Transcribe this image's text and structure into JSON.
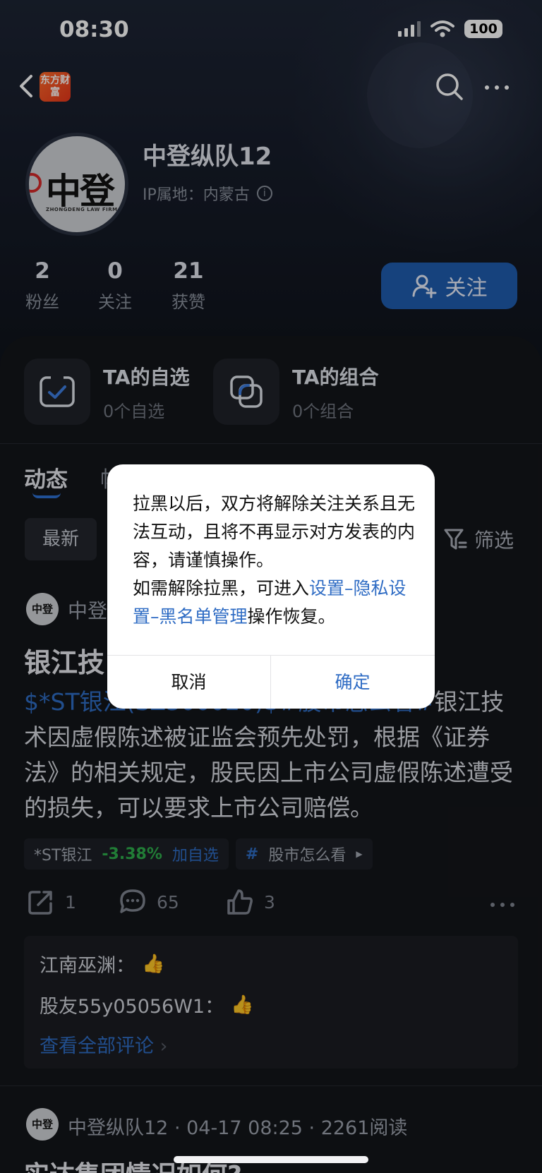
{
  "status": {
    "time": "08:30",
    "battery": "100"
  },
  "nav": {
    "logo": "东方财富"
  },
  "profile": {
    "avatar_text": "中登",
    "avatar_sub": "ZHONGDENG LAW FIRM",
    "name": "中登纵队12",
    "ip": "IP属地：内蒙古",
    "stats": [
      {
        "num": "2",
        "label": "粉丝"
      },
      {
        "num": "0",
        "label": "关注"
      },
      {
        "num": "21",
        "label": "获赞"
      }
    ],
    "follow_label": "关注"
  },
  "quick": [
    {
      "title": "TA的自选",
      "sub": "0个自选"
    },
    {
      "title": "TA的组合",
      "sub": "0个组合"
    }
  ],
  "tabs": {
    "active": "动态",
    "other": "帖"
  },
  "filter": {
    "chip": "最新",
    "label": "筛选"
  },
  "post": {
    "avatar_text": "中登",
    "author": "中登",
    "title": "银江技",
    "body_link": "$*ST银江(SZ300020)$#股市怎么看#",
    "body_text": "银江技术因虚假陈述被证监会预先处罚，根据《证券法》的相关规定，股民因上市公司虚假陈述遭受的损失，可以要求上市公司赔偿。",
    "stock_tag": {
      "name": "*ST银江",
      "pct": "-3.38%",
      "add": "加自选"
    },
    "topic_tag": {
      "hash": "#",
      "label": "股市怎么看"
    },
    "actions": {
      "share": "1",
      "comment": "65",
      "like": "3"
    },
    "comments": [
      {
        "user": "江南巫渊：",
        "emoji": "👍"
      },
      {
        "user": "股友55y05056W1：",
        "emoji": "👍"
      }
    ],
    "view_all": "查看全部评论"
  },
  "post2": {
    "avatar_text": "中登",
    "meta": "中登纵队12 · 04-17 08:25 · 2261阅读",
    "title": "实达集团情况如何?"
  },
  "dialog": {
    "line1": "拉黑以后，双方将解除关注关系且无法互动，且将不再显示对方发表的内容，请谨慎操作。",
    "line2_prefix": "如需解除拉黑，可进入",
    "line2_link": "设置–隐私设置–黑名单管理",
    "line2_suffix": "操作恢复。",
    "cancel": "取消",
    "confirm": "确定"
  },
  "colors": {
    "accent": "#2f6cc4",
    "follow_bg": "#1f5cae",
    "down": "#2fae4c"
  }
}
